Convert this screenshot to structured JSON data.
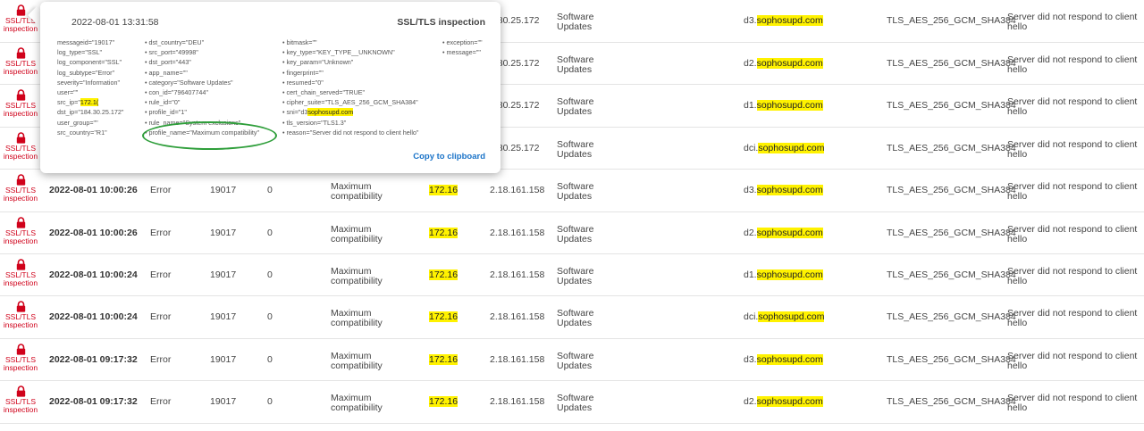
{
  "popup": {
    "date": "2022-08-01 13:31:58",
    "title": "SSL/TLS inspection",
    "copy_label": "Copy to clipboard",
    "col1": [
      "messageid=\"19017\"",
      "log_type=\"SSL\"",
      "log_component=\"SSL\"",
      "log_subtype=\"Error\"",
      "severity=\"Information\"",
      "user=\"\"",
      "src_ip=\"",
      "dst_ip=\"184.30.25.172\"",
      "user_group=\"\"",
      "src_country=\"R1\""
    ],
    "src_ip_highlight": "172.1(",
    "col2": [
      "dst_country=\"DEU\"",
      "src_port=\"49998\"",
      "dst_port=\"443\"",
      "app_name=\"\"",
      "category=\"Software Updates\"",
      "con_id=\"796407744\"",
      "rule_id=\"0\"",
      "profile_id=\"1\"",
      "rule_name=\"System exclusions\"",
      "profile_name=\"Maximum compatibility\""
    ],
    "col3": [
      "bitmask=\"\"",
      "key_type=\"KEY_TYPE__UNKNOWN\"",
      "key_param=\"Unknown\"",
      "fingerprint=\"\"",
      "resumed=\"0\"",
      "cert_chain_served=\"TRUE\"",
      "cipher_suite=\"TLS_AES_256_GCM_SHA384\"",
      "sni=\"d3",
      "tls_version=\"TLS1.3\"",
      "reason=\"Server did not respond to client hello\""
    ],
    "sni_highlight": "sophosupd.com",
    "col4": [
      "exception=\"\"",
      "message=\"\""
    ]
  },
  "lock_label_1": "SSL/TLS",
  "lock_label_2": "inspection",
  "rows": [
    {
      "time": "",
      "severity": "",
      "msgid": "",
      "rule": "",
      "profile": "",
      "src": "",
      "dst": "4.30.25.172",
      "cat": "Software Updates",
      "sni_pre": "d3.",
      "sni_dom": "sophosupd.com",
      "cipher": "TLS_AES_256_GCM_SHA384",
      "reason": "Server did not respond to client hello"
    },
    {
      "time": "",
      "severity": "",
      "msgid": "",
      "rule": "",
      "profile": "",
      "src": "",
      "dst": "4.30.25.172",
      "cat": "Software Updates",
      "sni_pre": "d2.",
      "sni_dom": "sophosupd.com",
      "cipher": "TLS_AES_256_GCM_SHA384",
      "reason": "Server did not respond to client hello"
    },
    {
      "time": "",
      "severity": "",
      "msgid": "",
      "rule": "",
      "profile": "",
      "src": "",
      "dst": "4.30.25.172",
      "cat": "Software Updates",
      "sni_pre": "d1.",
      "sni_dom": "sophosupd.com",
      "cipher": "TLS_AES_256_GCM_SHA384",
      "reason": "Server did not respond to client hello"
    },
    {
      "time": "",
      "severity": "",
      "msgid": "",
      "rule": "",
      "profile": "",
      "src": "",
      "dst": "4.30.25.172",
      "cat": "Software Updates",
      "sni_pre": "dci.",
      "sni_dom": "sophosupd.com",
      "cipher": "TLS_AES_256_GCM_SHA384",
      "reason": "Server did not respond to client hello"
    },
    {
      "time": "2022-08-01 10:00:26",
      "severity": "Error",
      "msgid": "19017",
      "rule": "0",
      "profile": "Maximum compatibility",
      "src": "172.16",
      "dst": "2.18.161.158",
      "cat": "Software Updates",
      "sni_pre": "d3.",
      "sni_dom": "sophosupd.com",
      "cipher": "TLS_AES_256_GCM_SHA384",
      "reason": "Server did not respond to client hello"
    },
    {
      "time": "2022-08-01 10:00:26",
      "severity": "Error",
      "msgid": "19017",
      "rule": "0",
      "profile": "Maximum compatibility",
      "src": "172.16",
      "dst": "2.18.161.158",
      "cat": "Software Updates",
      "sni_pre": "d2.",
      "sni_dom": "sophosupd.com",
      "cipher": "TLS_AES_256_GCM_SHA384",
      "reason": "Server did not respond to client hello"
    },
    {
      "time": "2022-08-01 10:00:24",
      "severity": "Error",
      "msgid": "19017",
      "rule": "0",
      "profile": "Maximum compatibility",
      "src": "172.16",
      "dst": "2.18.161.158",
      "cat": "Software Updates",
      "sni_pre": "d1.",
      "sni_dom": "sophosupd.com",
      "cipher": "TLS_AES_256_GCM_SHA384",
      "reason": "Server did not respond to client hello"
    },
    {
      "time": "2022-08-01 10:00:24",
      "severity": "Error",
      "msgid": "19017",
      "rule": "0",
      "profile": "Maximum compatibility",
      "src": "172.16",
      "dst": "2.18.161.158",
      "cat": "Software Updates",
      "sni_pre": "dci.",
      "sni_dom": "sophosupd.com",
      "cipher": "TLS_AES_256_GCM_SHA384",
      "reason": "Server did not respond to client hello"
    },
    {
      "time": "2022-08-01 09:17:32",
      "severity": "Error",
      "msgid": "19017",
      "rule": "0",
      "profile": "Maximum compatibility",
      "src": "172.16",
      "dst": "2.18.161.158",
      "cat": "Software Updates",
      "sni_pre": "d3.",
      "sni_dom": "sophosupd.com",
      "cipher": "TLS_AES_256_GCM_SHA384",
      "reason": "Server did not respond to client hello"
    },
    {
      "time": "2022-08-01 09:17:32",
      "severity": "Error",
      "msgid": "19017",
      "rule": "0",
      "profile": "Maximum compatibility",
      "src": "172.16",
      "dst": "2.18.161.158",
      "cat": "Software Updates",
      "sni_pre": "d2.",
      "sni_dom": "sophosupd.com",
      "cipher": "TLS_AES_256_GCM_SHA384",
      "reason": "Server did not respond to client hello"
    }
  ],
  "colors": {
    "lock": "#d0021b",
    "highlight": "#fff200",
    "link": "#1a73c8",
    "circle": "#2e9e3a"
  },
  "icons": {
    "row_icon": "lock-icon"
  }
}
